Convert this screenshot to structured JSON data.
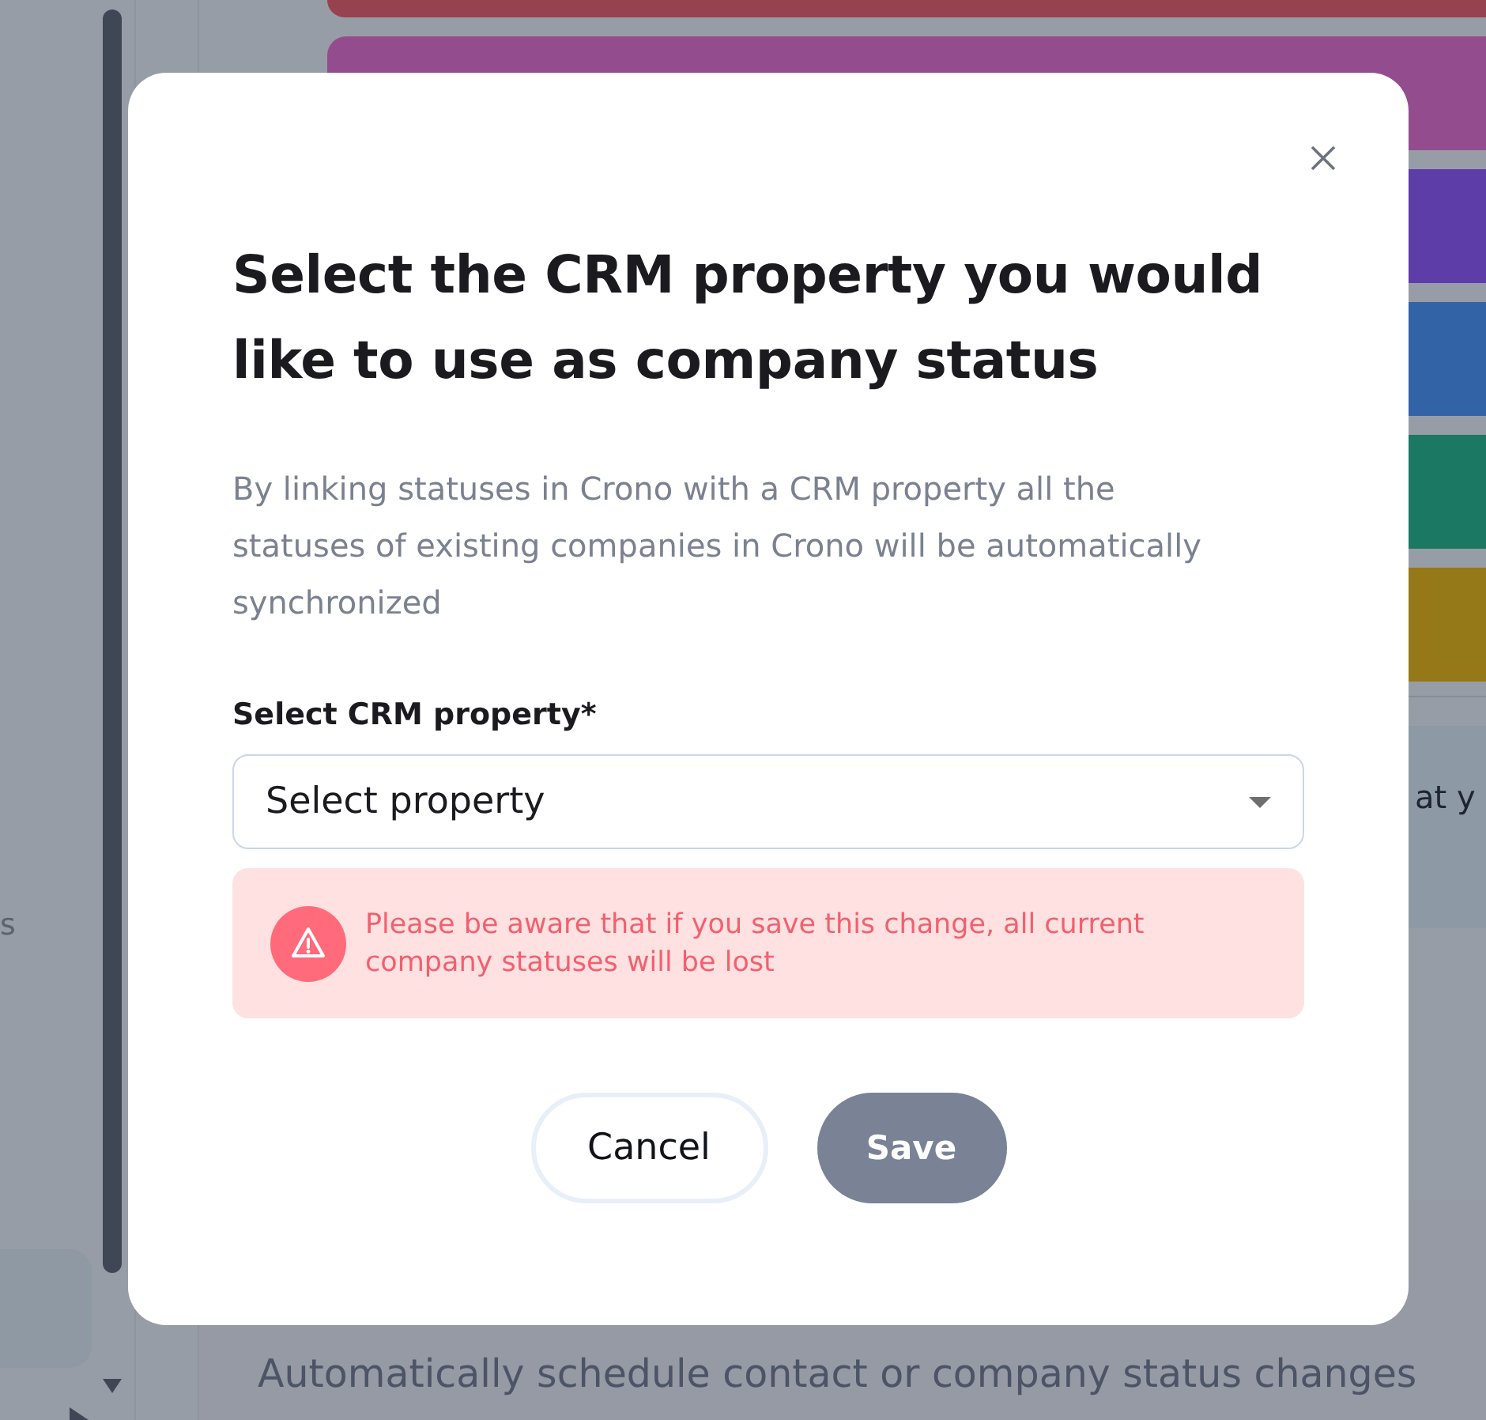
{
  "background": {
    "sidebar": {
      "label_fragment": "s"
    },
    "status_bars": [
      {
        "color": "#96434f"
      },
      {
        "color": "#934d8f"
      },
      {
        "color": "#5d3ea8"
      },
      {
        "color": "#3263a6"
      },
      {
        "color": "#1a7863"
      },
      {
        "color": "#957818"
      }
    ],
    "info_card": {
      "text_fragment": "at y"
    },
    "automation_section": {
      "description": "Automatically schedule contact or company status changes"
    }
  },
  "dialog": {
    "title": "Select the CRM property you would like to use as company status",
    "description": "By linking statuses in Crono with a CRM property all the statuses of existing companies in Crono will be automatically synchronized",
    "field": {
      "label": "Select CRM property*",
      "placeholder": "Select property"
    },
    "warning": {
      "message": "Please be aware that if you save this change, all current company statuses will be lost"
    },
    "buttons": [
      {
        "label": "Cancel",
        "kind": "secondary",
        "disabled": false
      },
      {
        "label": "Save",
        "kind": "primary",
        "disabled": true
      }
    ]
  }
}
